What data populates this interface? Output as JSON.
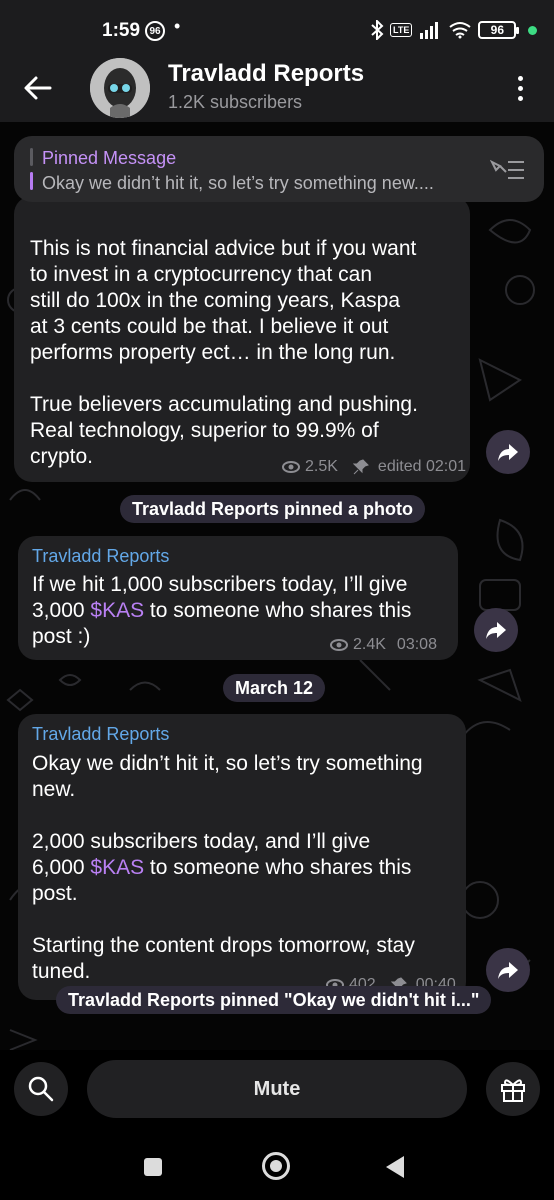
{
  "status_bar": {
    "time": "1:59",
    "notification_badge": "96",
    "battery": "96",
    "network": "LTE"
  },
  "header": {
    "title": "Travladd Reports",
    "subscribers": "1.2K subscribers"
  },
  "pinned": {
    "label": "Pinned Message",
    "preview": "Okay we didn’t hit it, so let’s try something new...."
  },
  "messages": [
    {
      "partial_line": "",
      "paragraph1": "This is not financial advice but if you want to invest in a cryptocurrency that can still do 100x in the coming years, Kaspa at 3 cents could be that. I believe it out performs property ect… in the long run.",
      "line1": "This is not financial advice but if you want",
      "line2": "to invest in a cryptocurrency that can",
      "line3": "still do 100x in the coming years, Kaspa",
      "line4": "at 3 cents could be that. I believe it out",
      "line5": "performs property ect… in the long run.",
      "line6": "True believers accumulating and pushing.",
      "line7": "Real technology, superior to 99.9% of",
      "line8": "crypto.",
      "views": "2.5K",
      "edited": "edited 02:01"
    },
    {
      "sender": "Travladd Reports",
      "line1": "If we hit 1,000 subscribers today, I’ll give",
      "line2_pre": "3,000 ",
      "line2_link": "$KAS",
      "line2_post": " to someone who shares this",
      "line3": "post :)",
      "views": "2.4K",
      "time": "03:08"
    },
    {
      "sender": "Travladd Reports",
      "line1": "Okay we didn’t hit it, so let’s try something",
      "line2": "new.",
      "line3": "2,000 subscribers today, and I’ll give",
      "line4_pre": "6,000 ",
      "line4_link": "$KAS",
      "line4_post": " to someone who shares this",
      "line5": "post.",
      "line6": "Starting the content drops tomorrow, stay",
      "line7": "tuned.",
      "views": "402",
      "time": "00:40"
    }
  ],
  "service_messages": {
    "pinned_photo": "Travladd Reports pinned a photo",
    "date": "March 12",
    "pinned_text": "Travladd Reports pinned \"Okay we didn't hit i...\""
  },
  "bottom": {
    "mute_label": "Mute"
  },
  "colors": {
    "accent_purple": "#b980f3",
    "sender_blue": "#63a8e8",
    "bubble_bg": "#212123"
  }
}
